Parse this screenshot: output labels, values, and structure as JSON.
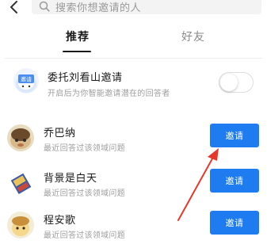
{
  "search": {
    "placeholder": "搜索你想邀请的人"
  },
  "tabs": [
    {
      "label": "推荐",
      "active": true
    },
    {
      "label": "好友",
      "active": false
    }
  ],
  "delegate": {
    "avatar_text": "邀请",
    "title": "委托刘看山邀请",
    "subtitle": "开启后为你智能邀请潜在的回答者",
    "toggle_on": false
  },
  "users": [
    {
      "name": "乔巴纳",
      "desc": "最近回答过该领域问题",
      "button": "邀请"
    },
    {
      "name": "背景是白天",
      "desc": "最近回答过该领域问题",
      "button": "邀请"
    },
    {
      "name": "程安歌",
      "desc": "最近回答过该领域问题",
      "button": "邀请"
    }
  ],
  "colors": {
    "accent": "#1e7cf0",
    "annotation_arrow": "#e8372a"
  }
}
